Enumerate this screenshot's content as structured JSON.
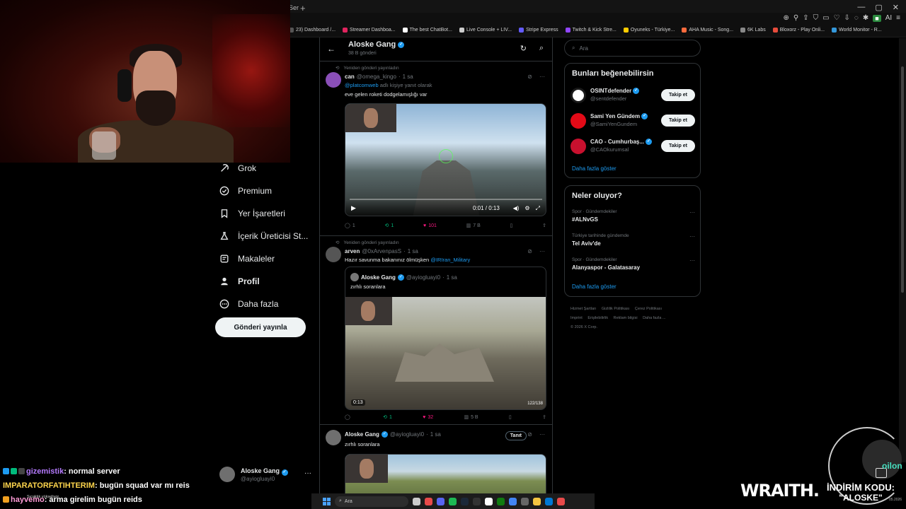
{
  "browser": {
    "tab_partial": "Ser",
    "bookmarks": [
      {
        "label": "23) Dashboard /...",
        "color": "#555555"
      },
      {
        "label": "Streamer Dashboa...",
        "color": "#e0245e"
      },
      {
        "label": "The best ChatBot...",
        "color": "#ffffff"
      },
      {
        "label": "Live Console + LIV...",
        "color": "#cccccc"
      },
      {
        "label": "Stripe Express",
        "color": "#635bff"
      },
      {
        "label": "Twitch & Kick Stre...",
        "color": "#9146ff"
      },
      {
        "label": "Oyuneks - Türkiye...",
        "color": "#ffcc00"
      },
      {
        "label": "AHA Music - Song...",
        "color": "#ff6b3d"
      },
      {
        "label": "6K Labs",
        "color": "#888888"
      },
      {
        "label": "Bloxorz - Play Onli...",
        "color": "#e74c3c"
      },
      {
        "label": "World Monitor - R...",
        "color": "#3498db"
      }
    ],
    "ext_label": "AI"
  },
  "nav": {
    "items": [
      {
        "label": "Grok",
        "icon": "grok-icon"
      },
      {
        "label": "Premium",
        "icon": "premium-icon"
      },
      {
        "label": "Yer İşaretleri",
        "icon": "bookmark-icon"
      },
      {
        "label": "İçerik Üreticisi St...",
        "icon": "creator-studio-icon"
      },
      {
        "label": "Makaleler",
        "icon": "articles-icon"
      },
      {
        "label": "Profil",
        "icon": "profile-icon"
      },
      {
        "label": "Daha fazla",
        "icon": "more-icon"
      }
    ],
    "post_button": "Gönderi yayınla",
    "account": {
      "name": "Aloske Gang",
      "handle": "@ayiogluayi0"
    }
  },
  "timeline": {
    "title": "Aloske Gang",
    "subtitle": "38 B gönderi",
    "posts": [
      {
        "repost_note": "Yeniden gönderi yayınladın",
        "name": "can",
        "handle": "@omega_kingo",
        "time": "1 sa",
        "reply_prefix": "@platcomweb",
        "reply_suffix": "adlı kişiye yanıt olarak",
        "text": "eve gelen roketi dodgelamışlığı var",
        "video_time": "0:01 / 0:13",
        "replies": "1",
        "reposts": "1",
        "likes": "101",
        "views": "7 B"
      },
      {
        "repost_note": "Yeniden gönderi yayınladın",
        "name": "arven",
        "handle": "@0xArvenpasS",
        "time": "1 sa",
        "text_prefix": "Hazır savunma bakanınız ölmüşken",
        "mention": "@IRIran_Military",
        "quote": {
          "name": "Aloske Gang",
          "handle": "@ayiogluayi0",
          "time": "1 sa",
          "text": "zırhlı soranlara",
          "video_time": "0:13",
          "ammo": "122/138"
        },
        "replies": "",
        "reposts": "1",
        "likes": "32",
        "views": "5 B"
      },
      {
        "name": "Aloske Gang",
        "handle": "@ayiogluayi0",
        "time": "1 sa",
        "promote": "Tanıt",
        "text": "zırhlı soranlara"
      }
    ]
  },
  "right": {
    "search_placeholder": "Ara",
    "who_to_follow": {
      "title": "Bunları beğenebilirsin",
      "follow_label": "Takip et",
      "users": [
        {
          "name": "OSINTdefender",
          "handle": "@sentdefender",
          "color": "#ffffff"
        },
        {
          "name": "Sami Yen Gündem",
          "handle": "@SamiYenGundem",
          "color": "#e30a17"
        },
        {
          "name": "CAO - Cumhurbaş...",
          "handle": "@CAOkurumsal",
          "color": "#c8102e"
        }
      ],
      "show_more": "Daha fazla göster"
    },
    "trends": {
      "title": "Neler oluyor?",
      "items": [
        {
          "context": "Spor · Gündemdekiler",
          "topic": "#ALNvGS"
        },
        {
          "context": "Türkiye tarihinde gündemde",
          "topic": "Tel Aviv'de"
        },
        {
          "context": "Spor · Gündemdekiler",
          "topic": "Alanyaspor - Galatasaray"
        }
      ],
      "show_more": "Daha fazla göster"
    },
    "footer": {
      "links": [
        "Hizmet Şartları",
        "Gizlilik Politikası",
        "Çerez Politikası",
        "Imprint",
        "Erişilebilirlik",
        "Reklam bilgisi",
        "Daha fazla ..."
      ],
      "copyright": "© 2026 X Corp."
    }
  },
  "chat": [
    {
      "user": "gizemistik",
      "message": ": normal server"
    },
    {
      "user": "IMPARATORFATIHTERIM",
      "message": ": bugün squad var mı reis"
    },
    {
      "user": "hayvemo",
      "message": ": arma girelim bugün reids"
    }
  ],
  "chat_small": "Sıcaklık yükseliyor",
  "taskbar": {
    "search": "Ara"
  },
  "sponsor": {
    "brand": "WRAITH.",
    "line1": "İNDİRİM KODU:",
    "line2": "\"ALOSKE\""
  },
  "corner_text": "oilon",
  "date_small": "05.2026"
}
